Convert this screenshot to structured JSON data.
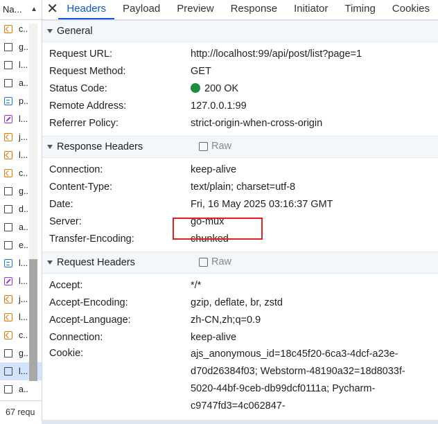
{
  "left_panel": {
    "header": "Na...",
    "items": [
      {
        "icon": "xhr-icon",
        "label": "c..",
        "selected": false
      },
      {
        "icon": "doc-icon",
        "label": "g..",
        "selected": false
      },
      {
        "icon": "doc-icon",
        "label": "l...",
        "selected": false
      },
      {
        "icon": "doc-icon",
        "label": "a..",
        "selected": false
      },
      {
        "icon": "css-icon",
        "label": "p..",
        "selected": false
      },
      {
        "icon": "img-icon",
        "label": "l...",
        "selected": false
      },
      {
        "icon": "xhr-icon",
        "label": "j...",
        "selected": false
      },
      {
        "icon": "xhr-icon",
        "label": "l...",
        "selected": false
      },
      {
        "icon": "xhr-icon",
        "label": "c..",
        "selected": false
      },
      {
        "icon": "doc-icon",
        "label": "g..",
        "selected": false
      },
      {
        "icon": "doc-icon",
        "label": "d..",
        "selected": false
      },
      {
        "icon": "doc-icon",
        "label": "a..",
        "selected": false
      },
      {
        "icon": "doc-icon",
        "label": "e..",
        "selected": false
      },
      {
        "icon": "css-icon",
        "label": "l...",
        "selected": false
      },
      {
        "icon": "img-icon",
        "label": "l...",
        "selected": false
      },
      {
        "icon": "xhr-icon",
        "label": "j...",
        "selected": false
      },
      {
        "icon": "xhr-icon",
        "label": "l...",
        "selected": false
      },
      {
        "icon": "xhr-icon",
        "label": "c..",
        "selected": false
      },
      {
        "icon": "doc-icon",
        "label": "g..",
        "selected": false
      },
      {
        "icon": "doc-icon",
        "label": "l...",
        "selected": true
      },
      {
        "icon": "doc-icon",
        "label": "a..",
        "selected": false
      }
    ],
    "footer": "67 requ"
  },
  "tabs": [
    "Headers",
    "Payload",
    "Preview",
    "Response",
    "Initiator",
    "Timing",
    "Cookies"
  ],
  "active_tab": "Headers",
  "general": {
    "title": "General",
    "rows": [
      {
        "key": "Request URL:",
        "value": "http://localhost:99/api/post/list?page=1"
      },
      {
        "key": "Request Method:",
        "value": "GET"
      },
      {
        "key": "Status Code:",
        "value": "200 OK",
        "status_color": "#1e8e3e"
      },
      {
        "key": "Remote Address:",
        "value": "127.0.0.1:99"
      },
      {
        "key": "Referrer Policy:",
        "value": "strict-origin-when-cross-origin"
      }
    ]
  },
  "response_headers": {
    "title": "Response Headers",
    "raw_label": "Raw",
    "rows": [
      {
        "key": "Connection:",
        "value": "keep-alive"
      },
      {
        "key": "Content-Type:",
        "value": "text/plain; charset=utf-8"
      },
      {
        "key": "Date:",
        "value": "Fri, 16 May 2025 03:16:37 GMT"
      },
      {
        "key": "Server:",
        "value": "go-mux"
      },
      {
        "key": "Transfer-Encoding:",
        "value": "chunked"
      }
    ]
  },
  "request_headers": {
    "title": "Request Headers",
    "raw_label": "Raw",
    "rows": [
      {
        "key": "Accept:",
        "value": "*/*"
      },
      {
        "key": "Accept-Encoding:",
        "value": "gzip, deflate, br, zstd"
      },
      {
        "key": "Accept-Language:",
        "value": "zh-CN,zh;q=0.9"
      },
      {
        "key": "Connection:",
        "value": "keep-alive"
      },
      {
        "key": "Cookie:",
        "value": "ajs_anonymous_id=18c45f20-6ca3-4dcf-a23e-d70d26384f03; Webstorm-48190a32=18d8033f-5020-44bf-9ceb-db99dcf0111a; Pycharm-c9747fd3=4c062847-"
      }
    ]
  },
  "colors": {
    "accent": "#0b57d0",
    "highlight": "#e02020",
    "status_ok": "#1e8e3e"
  }
}
